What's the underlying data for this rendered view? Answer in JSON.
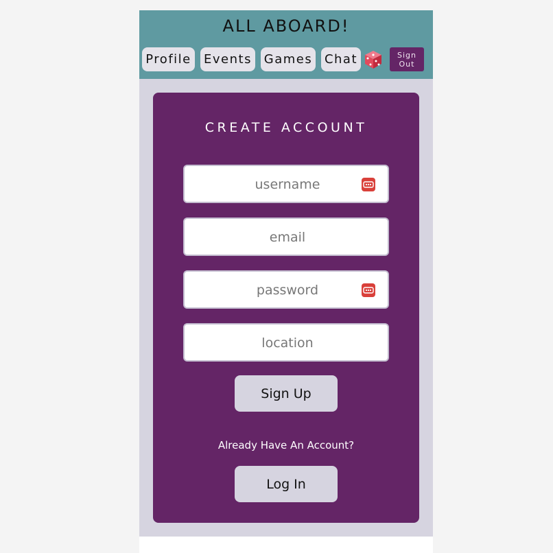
{
  "header": {
    "title": "ALL ABOARD!",
    "nav": [
      {
        "label": "Profile"
      },
      {
        "label": "Events"
      },
      {
        "label": "Games"
      },
      {
        "label": "Chat"
      }
    ],
    "dice_icon": "dice-icon",
    "signout_line1": "Sign",
    "signout_line2": "Out"
  },
  "form": {
    "title": "CREATE ACCOUNT",
    "username_placeholder": "username",
    "email_placeholder": "email",
    "password_placeholder": "password",
    "location_placeholder": "location",
    "signup_label": "Sign Up",
    "prompt": "Already Have An Account?",
    "login_label": "Log In"
  },
  "colors": {
    "header": "#5f9aa1",
    "card": "#642566",
    "panel": "#d6d4e0",
    "password_manager_icon": "#d9403a"
  }
}
